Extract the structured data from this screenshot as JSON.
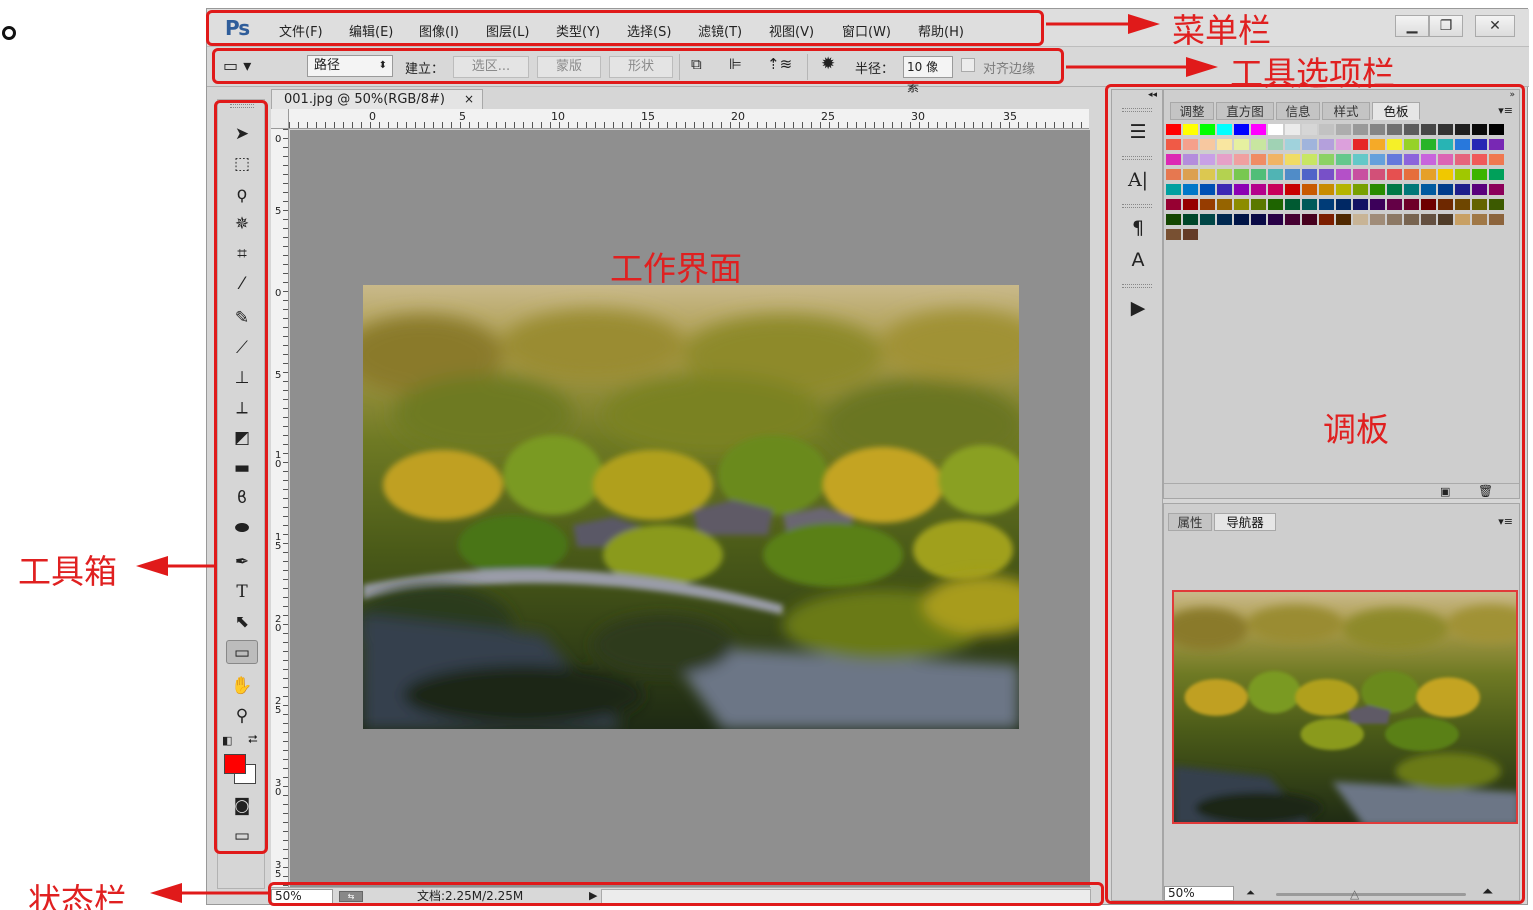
{
  "app": {
    "logo": "Ps",
    "menu": [
      "文件(F)",
      "编辑(E)",
      "图像(I)",
      "图层(L)",
      "类型(Y)",
      "选择(S)",
      "滤镜(T)",
      "视图(V)",
      "窗口(W)",
      "帮助(H)"
    ],
    "window_controls": [
      "minimize-icon",
      "restore-icon",
      "close-icon"
    ]
  },
  "options_bar": {
    "mode_value": "路径",
    "create_label": "建立：",
    "btn_selection": "选区...",
    "btn_mask": "蒙版",
    "btn_shape": "形状",
    "radius_label": "半径：",
    "radius_value": "10 像素",
    "align_edges_label": "对齐边缘",
    "align_edges_checked": false
  },
  "document": {
    "tab_title": "001.jpg @ 50%(RGB/8#)",
    "tab_close": "×",
    "ruler_top_ticks": [
      "0",
      "5",
      "10",
      "15",
      "20",
      "25",
      "30",
      "35"
    ],
    "ruler_left_ticks": [
      "0",
      "5",
      "0",
      "5",
      "10",
      "15",
      "20",
      "25",
      "30",
      "35"
    ]
  },
  "status_bar": {
    "zoom": "50%",
    "doc_info": "文档:2.25M/2.25M"
  },
  "panels": {
    "top_tabs": [
      "调整",
      "直方图",
      "信息",
      "样式",
      "色板"
    ],
    "top_active_tab": "色板",
    "bottom_tabs": [
      "属性",
      "导航器"
    ],
    "bottom_active_tab": "导航器",
    "navigator_zoom": "50%"
  },
  "swatch_colors": [
    "#ff0000",
    "#ffff00",
    "#00ff00",
    "#00ffff",
    "#0000ff",
    "#ff00ff",
    "#ffffff",
    "#ebebeb",
    "#d6d6d6",
    "#c2c2c2",
    "#adadad",
    "#999999",
    "#858585",
    "#707070",
    "#5c5c5c",
    "#474747",
    "#333333",
    "#1f1f1f",
    "#0a0a0a",
    "#000000",
    "#f05a46",
    "#f5a08c",
    "#f7c8a0",
    "#f9e6a0",
    "#e6f0a0",
    "#c8e6a0",
    "#a0d2b4",
    "#a0d2dc",
    "#a0b4dc",
    "#b4a0dc",
    "#dca0dc",
    "#e62828",
    "#f5aa28",
    "#f5f028",
    "#96d228",
    "#28b428",
    "#28b4b4",
    "#2878dc",
    "#2828b4",
    "#7828b4",
    "#dc28b4",
    "#b48cdc",
    "#c8a0e6",
    "#e6a0c8",
    "#f0a0a0",
    "#f08c64",
    "#f0b464",
    "#f0dc64",
    "#c8e664",
    "#8cd264",
    "#64c88c",
    "#64c8c8",
    "#64a0dc",
    "#6478dc",
    "#8c64dc",
    "#c864dc",
    "#dc64b4",
    "#e6647c",
    "#f05a5a",
    "#f07850",
    "#e67850",
    "#dca050",
    "#dcc850",
    "#b4d250",
    "#78c850",
    "#50be78",
    "#50b4b4",
    "#508cc8",
    "#5064c8",
    "#7850c8",
    "#b450c8",
    "#c850a0",
    "#d25078",
    "#e65050",
    "#e66e3c",
    "#e6a028",
    "#f0c800",
    "#a0c800",
    "#3cb400",
    "#00a05a",
    "#00a0a0",
    "#0078c8",
    "#0050b4",
    "#3c28b4",
    "#8c00b4",
    "#b4008c",
    "#c8005a",
    "#c80000",
    "#c85a00",
    "#c88c00",
    "#b4b400",
    "#78a000",
    "#288c00",
    "#007846",
    "#007878",
    "#005aa0",
    "#003c8c",
    "#1e1e8c",
    "#5a007c",
    "#8c005a",
    "#960032",
    "#960000",
    "#963c00",
    "#966400",
    "#8c8c00",
    "#5a7800",
    "#1e6400",
    "#005a32",
    "#005a5a",
    "#003c78",
    "#002864",
    "#141464",
    "#3c005a",
    "#640046",
    "#6e0028",
    "#6e0000",
    "#6e2800",
    "#6e4600",
    "#646400",
    "#3c5a00",
    "#144600",
    "#004628",
    "#004646",
    "#002850",
    "#001446",
    "#0a0a46",
    "#280046",
    "#460032",
    "#46001e",
    "#7c1e00",
    "#502800",
    "#c8b496",
    "#a08c78",
    "#8c7864",
    "#786450",
    "#645040",
    "#503c28",
    "#c8a064",
    "#a07846",
    "#8c643c",
    "#785032",
    "#643c28"
  ],
  "annotations": {
    "menu_bar": "菜单栏",
    "options_bar": "工具选项栏",
    "workspace": "工作界面",
    "palette": "调板",
    "toolbox": "工具箱",
    "status_bar": "状态栏"
  },
  "accent": "#e01a1a"
}
